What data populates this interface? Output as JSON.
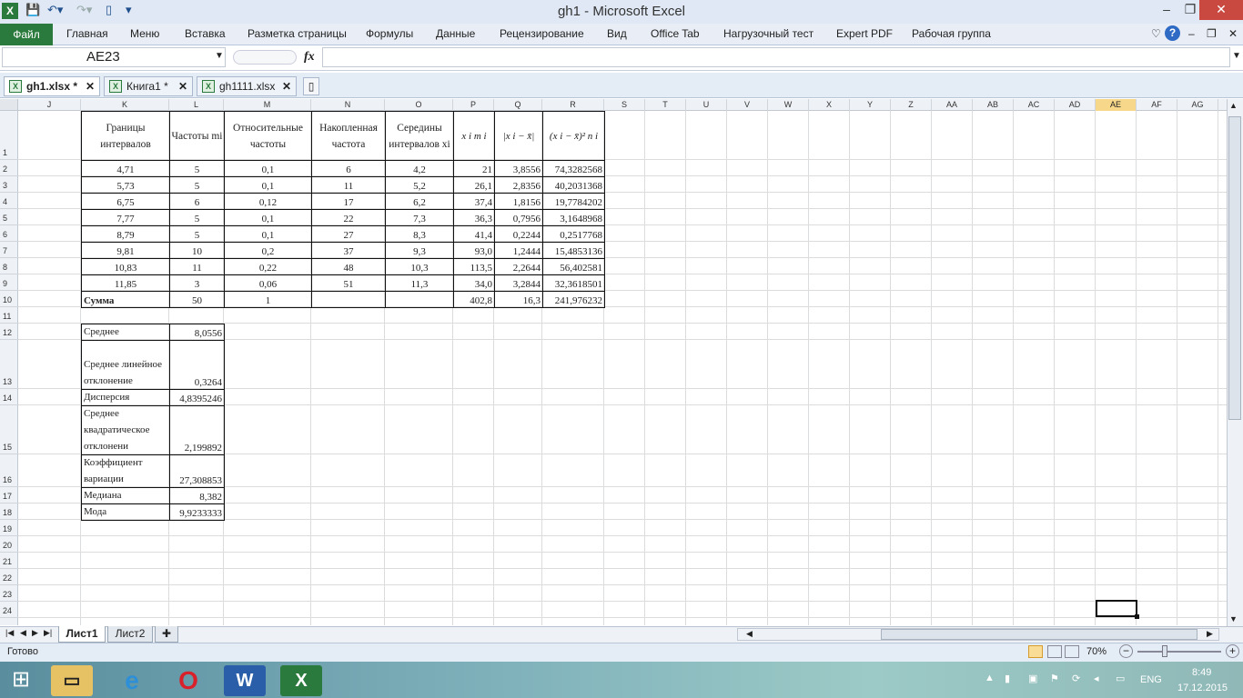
{
  "window": {
    "title": "gh1  -  Microsoft Excel"
  },
  "quick_access": {
    "save_icon": "save-icon",
    "undo_icon": "undo-icon",
    "redo_icon": "redo-icon",
    "new_icon": "new-file-icon"
  },
  "window_controls": {
    "minimize": "–",
    "restore": "❐",
    "close": "✕"
  },
  "ribbon": {
    "file_tab": "Файл",
    "tabs": [
      "Главная",
      "Меню",
      "Вставка",
      "Разметка страницы",
      "Формулы",
      "Данные",
      "Рецензирование",
      "Вид",
      "Office Tab",
      "Нагрузочный тест",
      "Expert PDF",
      "Рабочая группа"
    ]
  },
  "formula_bar": {
    "name_box": "AE23",
    "fx_label": "fx",
    "value": ""
  },
  "doc_tabs": [
    {
      "label": "gh1.xlsx *",
      "close": "✕"
    },
    {
      "label": "Книга1 *",
      "close": "✕"
    },
    {
      "label": "gh1111.xlsx",
      "close": "✕"
    }
  ],
  "columns": [
    "J",
    "K",
    "L",
    "M",
    "N",
    "O",
    "P",
    "Q",
    "R",
    "S",
    "T",
    "U",
    "V",
    "W",
    "X",
    "Y",
    "Z",
    "AA",
    "AB",
    "AC",
    "AD",
    "AE",
    "AF",
    "AG"
  ],
  "selected_column": "AE",
  "rows": [
    "1",
    "2",
    "3",
    "4",
    "5",
    "6",
    "7",
    "8",
    "9",
    "10",
    "11",
    "12",
    "13",
    "14",
    "15",
    "16",
    "17",
    "18",
    "19",
    "20",
    "21",
    "22",
    "23",
    "24"
  ],
  "table": {
    "headers": {
      "K": "Границы интервалов",
      "L": "Частоты mi",
      "M": "Относительные частоты",
      "N": "Накопленная частота",
      "O": "Середины интервалов xi",
      "P": "x i m i",
      "Q": "|x i − x̄|",
      "R": "(x i − x̄)² n i"
    },
    "rows": [
      [
        "4,71",
        "5",
        "0,1",
        "6",
        "4,2",
        "21",
        "3,8556",
        "74,3282568"
      ],
      [
        "5,73",
        "5",
        "0,1",
        "11",
        "5,2",
        "26,1",
        "2,8356",
        "40,2031368"
      ],
      [
        "6,75",
        "6",
        "0,12",
        "17",
        "6,2",
        "37,4",
        "1,8156",
        "19,7784202"
      ],
      [
        "7,77",
        "5",
        "0,1",
        "22",
        "7,3",
        "36,3",
        "0,7956",
        "3,1648968"
      ],
      [
        "8,79",
        "5",
        "0,1",
        "27",
        "8,3",
        "41,4",
        "0,2244",
        "0,2517768"
      ],
      [
        "9,81",
        "10",
        "0,2",
        "37",
        "9,3",
        "93,0",
        "1,2444",
        "15,4853136"
      ],
      [
        "10,83",
        "11",
        "0,22",
        "48",
        "10,3",
        "113,5",
        "2,2644",
        "56,402581"
      ],
      [
        "11,85",
        "3",
        "0,06",
        "51",
        "11,3",
        "34,0",
        "3,2844",
        "32,3618501"
      ]
    ],
    "total": {
      "label": "Сумма",
      "L": "50",
      "M": "1",
      "N": "",
      "O": "",
      "P": "402,8",
      "Q": "16,3",
      "R": "241,976232"
    }
  },
  "stats": [
    {
      "label": "Среднее",
      "value": "8,0556"
    },
    {
      "label": "Среднее линейное отклонение",
      "value": "0,3264"
    },
    {
      "label": "Дисперсия",
      "value": "4,8395246"
    },
    {
      "label": "Среднее квадратическое отклонени",
      "value": "2,199892"
    },
    {
      "label": "Коэффициент вариации",
      "value": "27,308853"
    },
    {
      "label": "Медиана",
      "value": "8,382"
    },
    {
      "label": "Мода",
      "value": "9,9233333"
    }
  ],
  "sheets": {
    "tabs": [
      "Лист1",
      "Лист2"
    ],
    "active": "Лист1"
  },
  "status": {
    "ready": "Готово",
    "zoom": "70%"
  },
  "taskbar": {
    "lang": "ENG",
    "time": "8:49",
    "date": "17.12.2015"
  },
  "colors": {
    "accent": "#2b7a3d",
    "selected_header": "#f7d88b",
    "close": "#c9483f"
  }
}
